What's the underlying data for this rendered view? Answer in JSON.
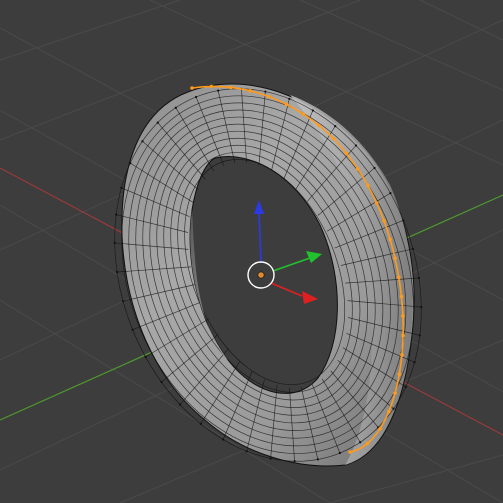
{
  "viewport": {
    "background": "#3d3d3d",
    "grid_color": "#4a4a4a",
    "x_axis_color": "#9a3a3a",
    "y_axis_color": "#4e9a2e"
  },
  "object": {
    "type": "torus",
    "face_color": "#9c9c9c",
    "edge_color": "#111111",
    "selection_color": "#ff9a1a",
    "selection": "edge-loop"
  },
  "gizmo": {
    "x_arrow_color": "#e02020",
    "y_arrow_color": "#22c22e",
    "z_arrow_color": "#2a3ae6",
    "origin_color": "#e08a30",
    "cursor_color": "#ffffff"
  }
}
